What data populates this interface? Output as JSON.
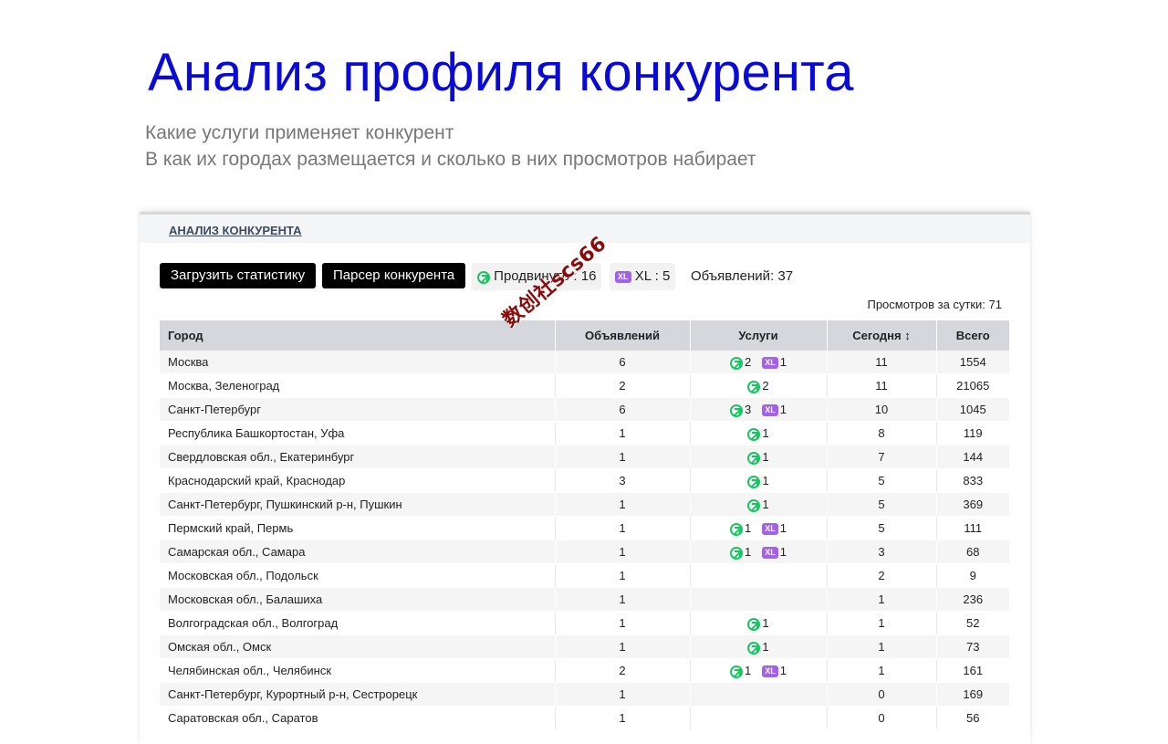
{
  "page": {
    "title": "Анализ профиля конкурента",
    "subtitle_line1": "Какие услуги применяет конкурент",
    "subtitle_line2": "В как их городах размещается и сколько в них просмотров набирает"
  },
  "panel": {
    "tab_label": "АНАЛИЗ КОНКУРЕНТА",
    "load_stats_button": "Загрузить статистику",
    "parser_button": "Парсер конкурента",
    "promoted_label": "Продвинуто : 16",
    "xl_label": "XL : 5",
    "xl_badge": "XL",
    "ads_total": "Объявлений: 37",
    "views_per_day": "Просмотров за сутки: 71"
  },
  "colors": {
    "promo": "#12c95e",
    "xl": "#a461e8",
    "title": "#0a0ad6"
  },
  "table": {
    "columns": [
      "Город",
      "Объявлений",
      "Услуги",
      "Сегодня ↕",
      "Всего"
    ],
    "rows": [
      {
        "city": "Москва",
        "ads": "6",
        "promo": "2",
        "xl": "1",
        "today": "11",
        "total": "1554"
      },
      {
        "city": "Москва, Зеленоград",
        "ads": "2",
        "promo": "2",
        "xl": "",
        "today": "11",
        "total": "21065"
      },
      {
        "city": "Санкт-Петербург",
        "ads": "6",
        "promo": "3",
        "xl": "1",
        "today": "10",
        "total": "1045"
      },
      {
        "city": "Республика Башкортостан, Уфа",
        "ads": "1",
        "promo": "1",
        "xl": "",
        "today": "8",
        "total": "119"
      },
      {
        "city": "Свердловская обл., Екатеринбург",
        "ads": "1",
        "promo": "1",
        "xl": "",
        "today": "7",
        "total": "144"
      },
      {
        "city": "Краснодарский край, Краснодар",
        "ads": "3",
        "promo": "1",
        "xl": "",
        "today": "5",
        "total": "833"
      },
      {
        "city": "Санкт-Петербург, Пушкинский р-н, Пушкин",
        "ads": "1",
        "promo": "1",
        "xl": "",
        "today": "5",
        "total": "369"
      },
      {
        "city": "Пермский край, Пермь",
        "ads": "1",
        "promo": "1",
        "xl": "1",
        "today": "5",
        "total": "111"
      },
      {
        "city": "Самарская обл., Самара",
        "ads": "1",
        "promo": "1",
        "xl": "1",
        "today": "3",
        "total": "68"
      },
      {
        "city": "Московская обл., Подольск",
        "ads": "1",
        "promo": "",
        "xl": "",
        "today": "2",
        "total": "9"
      },
      {
        "city": "Московская обл., Балашиха",
        "ads": "1",
        "promo": "",
        "xl": "",
        "today": "1",
        "total": "236"
      },
      {
        "city": "Волгоградская обл., Волгоград",
        "ads": "1",
        "promo": "1",
        "xl": "",
        "today": "1",
        "total": "52"
      },
      {
        "city": "Омская обл., Омск",
        "ads": "1",
        "promo": "1",
        "xl": "",
        "today": "1",
        "total": "73"
      },
      {
        "city": "Челябинская обл., Челябинск",
        "ads": "2",
        "promo": "1",
        "xl": "1",
        "today": "1",
        "total": "161"
      },
      {
        "city": "Санкт-Петербург, Курортный р-н, Сестрорецк",
        "ads": "1",
        "promo": "",
        "xl": "",
        "today": "0",
        "total": "169"
      },
      {
        "city": "Саратовская обл., Саратов",
        "ads": "1",
        "promo": "",
        "xl": "",
        "today": "0",
        "total": "56"
      }
    ]
  },
  "watermark": "数创社scs66"
}
